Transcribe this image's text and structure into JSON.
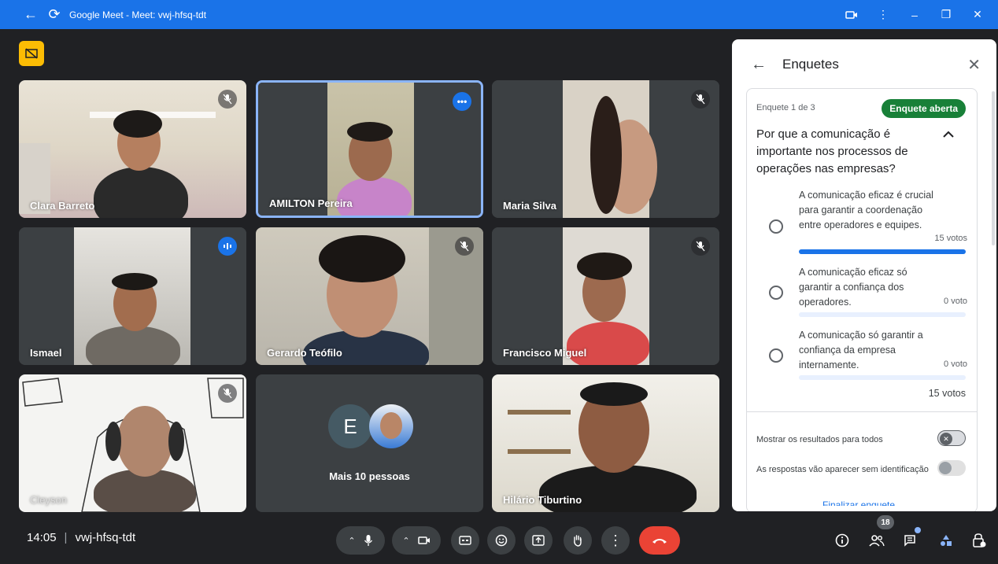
{
  "window": {
    "title": "Google Meet - Meet: vwj-hfsq-tdt"
  },
  "participants": [
    {
      "name": "Clara Barreto",
      "mic": "muted"
    },
    {
      "name": "AMILTON Pereira",
      "mic": "more-options"
    },
    {
      "name": "Maria Silva",
      "mic": "muted"
    },
    {
      "name": "Ismael",
      "mic": "speaking"
    },
    {
      "name": "Gerardo Teófilo",
      "mic": "muted"
    },
    {
      "name": "Francisco Miguel",
      "mic": "muted"
    },
    {
      "name": "Cleyson",
      "mic": "muted"
    },
    {
      "name": "Mais 10 pessoas",
      "avatar_letter": "E"
    },
    {
      "name": "Hilário Tiburtino"
    }
  ],
  "poll_panel": {
    "title": "Enquetes",
    "meta": "Enquete 1 de 3",
    "status": "Enquete aberta",
    "question": "Por que a comunicação é importante nos processos de operações nas empresas?",
    "options": [
      {
        "text": "A comunicação eficaz é crucial para garantir a coordenação entre operadores e equipes.",
        "votes": "15 votos",
        "share": 1.0
      },
      {
        "text": "A comunicação eficaz só garantir a confiança dos operadores.",
        "votes": "0 voto",
        "share": 0.0
      },
      {
        "text": "A comunicação só garantir a confiança da empresa internamente.",
        "votes": "0 voto",
        "share": 0.0
      }
    ],
    "total": "15 votos",
    "settings": [
      {
        "label": "Mostrar os resultados para todos",
        "state": "off"
      },
      {
        "label": "As respostas vão aparecer sem identificação",
        "state": "off"
      }
    ],
    "end_link": "Finalizar enquete"
  },
  "bottom_bar": {
    "time": "14:05",
    "meeting_code": "vwj-hfsq-tdt",
    "people_count": "18"
  },
  "colors": {
    "accent": "#1a73e8",
    "poll_open": "#188038",
    "end_call": "#ea4335",
    "background": "#202124"
  }
}
